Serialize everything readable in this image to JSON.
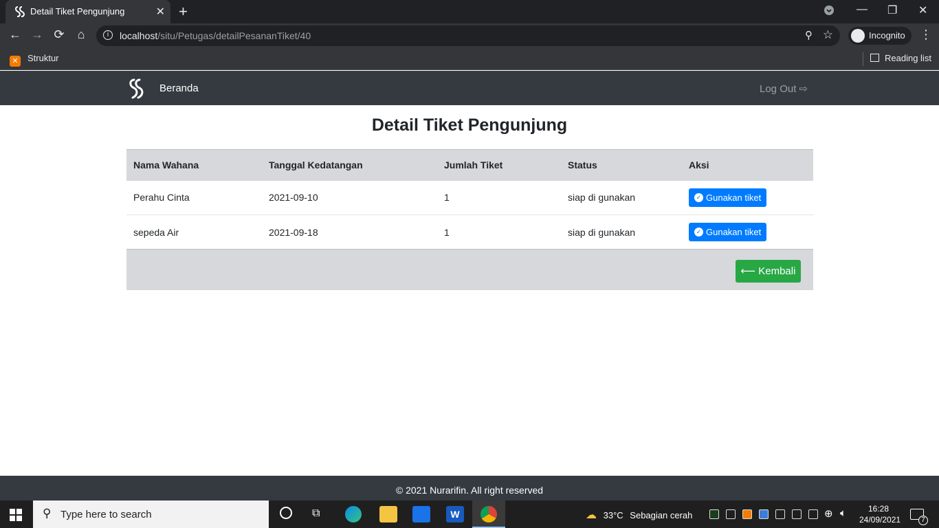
{
  "browser": {
    "tab_title": "Detail Tiket Pengunjung",
    "url_host": "localhost",
    "url_path": "/situ/Petugas/detailPesananTiket/40",
    "profile_label": "Incognito",
    "bookmark_label": "Struktur",
    "reading_list_label": "Reading list"
  },
  "site_nav": {
    "home_label": "Beranda",
    "logout_label": "Log Out"
  },
  "main": {
    "title": "Detail Tiket Pengunjung",
    "columns": [
      "Nama Wahana",
      "Tanggal Kedatangan",
      "Jumlah Tiket",
      "Status",
      "Aksi"
    ],
    "rows": [
      {
        "nama": "Perahu Cinta",
        "tanggal": "2021-09-10",
        "jumlah": "1",
        "status": "siap di gunakan",
        "aksi": "Gunakan tiket"
      },
      {
        "nama": "sepeda Air",
        "tanggal": "2021-09-18",
        "jumlah": "1",
        "status": "siap di gunakan",
        "aksi": "Gunakan tiket"
      }
    ],
    "back_label": "Kembali"
  },
  "footer": {
    "text": "© 2021 Nurarifin. All right reserved"
  },
  "taskbar": {
    "search_placeholder": "Type here to search",
    "temperature": "33°C",
    "weather_text": "Sebagian cerah",
    "time": "16:28",
    "date": "24/09/2021",
    "notification_count": "7"
  },
  "colors": {
    "navbar": "#343a40",
    "primary": "#007bff",
    "success": "#28a745",
    "table_head": "#d6d8db"
  }
}
